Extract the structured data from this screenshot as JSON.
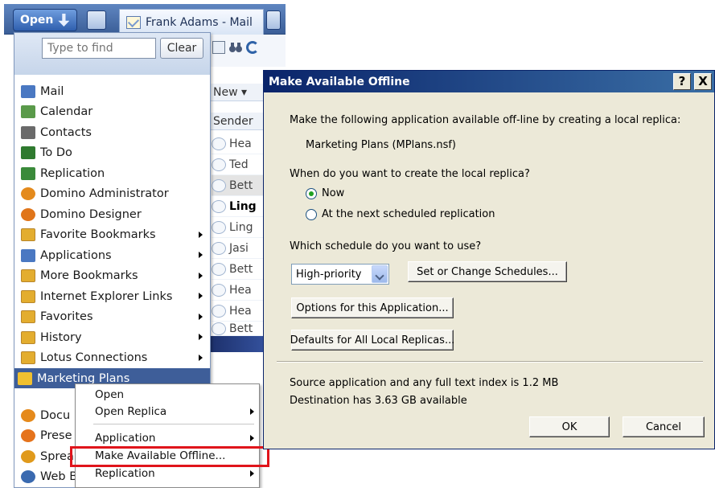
{
  "toolbar": {
    "open_label": "Open",
    "mail_tab_label": "Frank Adams - Mail"
  },
  "mail_list": {
    "new_label": "New ▾",
    "sender_header": "Sender",
    "rows": [
      "Hea",
      "Ted",
      "Bett",
      "Ling",
      "Ling",
      "Jasi",
      "Bett",
      "Hea",
      "Hea",
      "Bett"
    ]
  },
  "open_menu": {
    "search_placeholder": "Type to find",
    "clear_label": "Clear",
    "items": [
      {
        "label": "Mail",
        "icon": "mail-icon",
        "color": "#4a78c2"
      },
      {
        "label": "Calendar",
        "icon": "calendar-icon",
        "color": "#5a9a4a"
      },
      {
        "label": "Contacts",
        "icon": "contacts-icon",
        "color": "#6a6a6a"
      },
      {
        "label": "To Do",
        "icon": "todo-icon",
        "color": "#2f7a2f"
      },
      {
        "label": "Replication",
        "icon": "replication-icon",
        "color": "#3a8a3a"
      },
      {
        "label": "Domino Administrator",
        "icon": "domino-administrator-icon",
        "color": "#e48a1c"
      },
      {
        "label": "Domino Designer",
        "icon": "domino-designer-icon",
        "color": "#e0751a"
      },
      {
        "label": "Favorite Bookmarks",
        "icon": "favorite-bookmarks-icon",
        "color": "#e3ad2f"
      },
      {
        "label": "Applications",
        "icon": "applications-icon",
        "color": "#4a78c2"
      },
      {
        "label": "More Bookmarks",
        "icon": "folder-icon",
        "color": "#e3ad2f"
      },
      {
        "label": "Internet Explorer Links",
        "icon": "ie-links-icon",
        "color": "#e3ad2f"
      },
      {
        "label": "Favorites",
        "icon": "folder-icon",
        "color": "#e3ad2f"
      },
      {
        "label": "History",
        "icon": "history-icon",
        "color": "#e3ad2f"
      },
      {
        "label": "Lotus Connections",
        "icon": "folder-icon",
        "color": "#e3ad2f"
      },
      {
        "label": "Marketing Plans",
        "icon": "marketing-plans-icon",
        "color": "#f0c030"
      },
      {
        "label": "Docu",
        "icon": "documents-icon",
        "color": "#e58a1c"
      },
      {
        "label": "Prese",
        "icon": "presentations-icon",
        "color": "#e5731c"
      },
      {
        "label": "Sprea",
        "icon": "spreadsheets-icon",
        "color": "#e09a1c"
      },
      {
        "label": "Web B",
        "icon": "web-browser-icon",
        "color": "#3a6ab0"
      }
    ]
  },
  "context_menu": {
    "items": [
      {
        "label": "Open",
        "submenu": false
      },
      {
        "label": "Open Replica",
        "submenu": true
      },
      {
        "label": "Application",
        "submenu": true
      },
      {
        "label": "Make Available Offline...",
        "submenu": false
      },
      {
        "label": "Replication",
        "submenu": true
      }
    ]
  },
  "dialog": {
    "title": "Make Available Offline",
    "help_label": "?",
    "close_label": "X",
    "intro": "Make the following application available off-line by creating a local replica:",
    "app_name": "Marketing Plans (MPlans.nsf)",
    "when_question": "When do you want to create the local replica?",
    "radio_now": "Now",
    "radio_next": "At the next scheduled replication",
    "schedule_question": "Which schedule do you want to use?",
    "schedule_value": "High-priority",
    "set_schedules_label": "Set or Change Schedules...",
    "options_label": "Options for this Application...",
    "defaults_label": "Defaults for All Local Replicas...",
    "source_info": "Source application and any full text index is 1.2 MB",
    "dest_info": "Destination has 3.63 GB available",
    "ok_label": "OK",
    "cancel_label": "Cancel"
  }
}
